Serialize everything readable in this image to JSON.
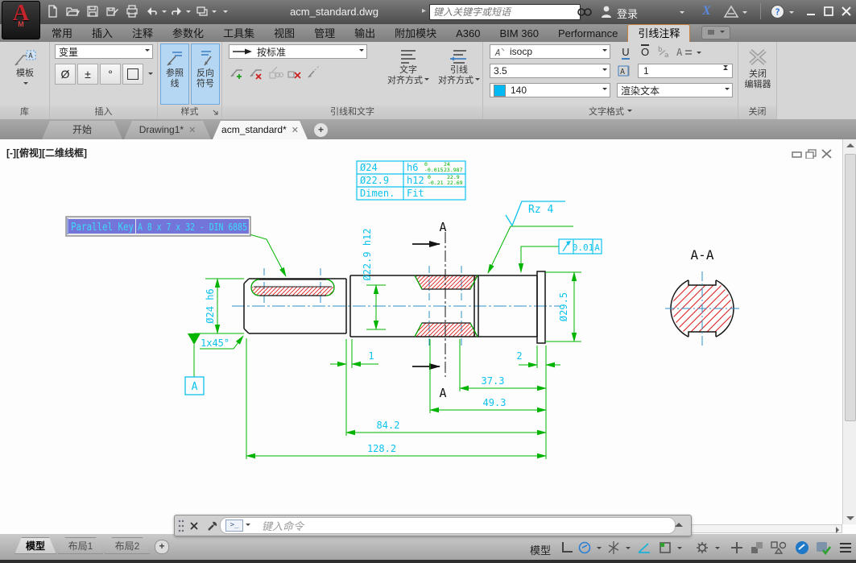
{
  "title_bar": {
    "app_title": "acm_standard.dwg",
    "search_placeholder": "键入关键字或短语",
    "sign_in": "登录"
  },
  "ribbon_tabs": {
    "home": "常用",
    "insert": "插入",
    "annotate": "注释",
    "parametric": "参数化",
    "toolsets": "工具集",
    "view": "视图",
    "manage": "管理",
    "output": "输出",
    "addins": "附加模块",
    "a360": "A360",
    "bim360": "BIM 360",
    "performance": "Performance",
    "leader": "引线注释"
  },
  "ribbon": {
    "library": {
      "label": "库",
      "template": "模板"
    },
    "insert_panel": {
      "label": "插入",
      "variable": "变量",
      "diameter": "Ø",
      "plusminus": "±",
      "degree": "°"
    },
    "style_panel": {
      "label": "样式",
      "ref_line_1": "参照",
      "ref_line_2": "线",
      "reverse_1": "反向",
      "reverse_2": "符号"
    },
    "leader_panel": {
      "label": "引线和文字",
      "standard": "按标准",
      "text_align_1": "文字",
      "text_align_2": "对齐方式",
      "leader_align_1": "引线",
      "leader_align_2": "对齐方式"
    },
    "format_panel": {
      "label": "文字格式",
      "font": "isocp",
      "underline": "U",
      "overline": "O",
      "size": "3.5",
      "tracking": "1",
      "color": "140",
      "color_hex": "#00b9f2",
      "render": "渲染文本"
    },
    "close_panel": {
      "label": "关闭",
      "close_1": "关闭",
      "close_2": "编辑器"
    }
  },
  "file_tabs": {
    "start": "开始",
    "t1": "Drawing1*",
    "t2": "acm_standard*"
  },
  "viewport": {
    "label": "[-][俯视][二维线框]"
  },
  "drawing": {
    "table": {
      "r1c1": "Ø24",
      "r1c2": "h6",
      "r1_tol_u": "0",
      "r1_tol_l": "-0.015",
      "r1_lim_u": "24",
      "r1_lim_l": "23.987",
      "r2c1": "Ø22.9",
      "r2c2": "h12",
      "r2_tol_u": "0",
      "r2_tol_l": "-0.21",
      "r2_lim_u": "22.9",
      "r2_lim_l": "22.69",
      "r3c1": "Dimen.",
      "r3c2": "Fit"
    },
    "key_note_1": "Parallel Key",
    "key_note_2": "A 8 x 7 x 32 - DIN 6885",
    "roughness": "Rz 4",
    "fcf_value": "0.01",
    "fcf_datum": "A",
    "datum": "A",
    "chamfer": "1x45°",
    "section_mark_top": "A",
    "section_mark_bottom": "A",
    "section_title": "A-A",
    "dim_d24": "Ø24 h6",
    "dim_d229": "Ø22.9 h12",
    "dim_d295": "Ø29.5",
    "dim_1": "1",
    "dim_2": "2",
    "dim_37": "37.3",
    "dim_49": "49.3",
    "dim_84": "84.2",
    "dim_128": "128.2",
    "colors": {
      "dim_green": "#00b400",
      "cad_cyan": "#0cc2ee",
      "hatch_red": "#e02020",
      "center_blue": "#2f8fc7"
    }
  },
  "command_bar": {
    "placeholder": "键入命令"
  },
  "status_bar": {
    "model_tab": "模型",
    "layout1": "布局1",
    "layout2": "布局2",
    "model_label": "模型"
  }
}
